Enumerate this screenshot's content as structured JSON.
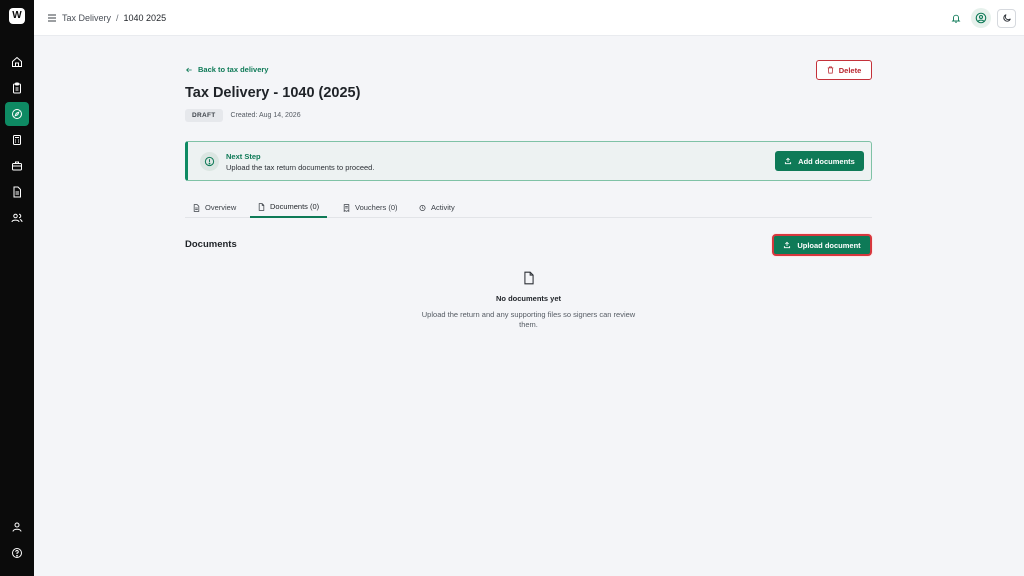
{
  "app": {
    "logo_text": "W"
  },
  "sidebar": {
    "items": [
      {
        "icon": "home-icon"
      },
      {
        "icon": "clipboard-icon"
      },
      {
        "icon": "compass-icon",
        "active": true
      },
      {
        "icon": "calculator-icon"
      },
      {
        "icon": "briefcase-icon"
      },
      {
        "icon": "document-icon"
      },
      {
        "icon": "users-icon"
      }
    ],
    "bottom_items": [
      {
        "icon": "user-icon"
      },
      {
        "icon": "help-icon"
      }
    ]
  },
  "topbar": {
    "breadcrumb": [
      "Tax Delivery",
      "1040 2025"
    ],
    "separator": "/"
  },
  "header": {
    "back_label": "Back to tax delivery",
    "delete_label": "Delete",
    "title": "Tax Delivery - 1040 (2025)",
    "status": "DRAFT",
    "created": "Created: Aug 14, 2026"
  },
  "next_step": {
    "title": "Next Step",
    "description": "Upload the tax return documents to proceed.",
    "action_label": "Add documents"
  },
  "tabs": [
    {
      "label": "Overview",
      "icon": "document-icon",
      "active": false
    },
    {
      "label": "Documents (0)",
      "icon": "file-icon",
      "active": true
    },
    {
      "label": "Vouchers (0)",
      "icon": "receipt-icon",
      "active": false
    },
    {
      "label": "Activity",
      "icon": "clock-icon",
      "active": false
    }
  ],
  "documents": {
    "section_title": "Documents",
    "upload_label": "Upload document",
    "empty_title": "No documents yet",
    "empty_description": "Upload the return and any supporting files so signers can review them."
  },
  "colors": {
    "brand": "#0e7a57",
    "danger": "#c4313a",
    "sidebar_bg": "#0b0b0b",
    "page_bg": "#f4f5f8"
  }
}
